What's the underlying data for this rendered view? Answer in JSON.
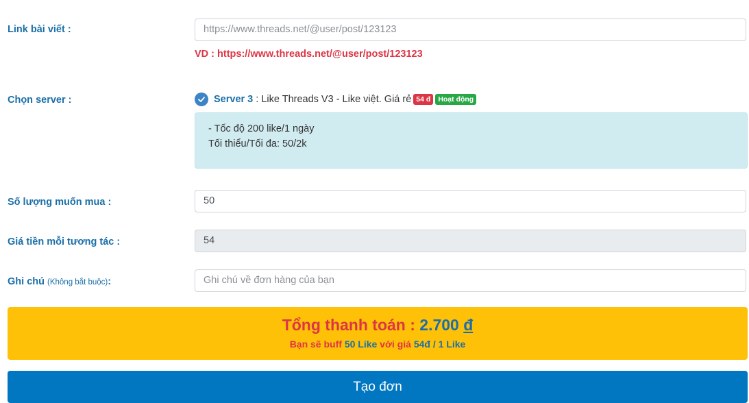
{
  "link": {
    "label": "Link bài viết :",
    "placeholder": "https://www.threads.net/@user/post/123123",
    "example": "VD : https://www.threads.net/@user/post/123123"
  },
  "server": {
    "label": "Chọn server :",
    "name": "Server 3",
    "separator": " : ",
    "description": "Like Threads V3 - Like việt. Giá rẻ",
    "price_badge": "54 đ",
    "status_badge": "Hoạt động",
    "info_line1": "- Tốc độ 200 like/1 ngày",
    "info_line2": "Tối thiểu/Tối đa: 50/2k"
  },
  "quantity": {
    "label": "Số lượng muốn mua :",
    "value": "50"
  },
  "unit_price": {
    "label": "Giá tiền mỗi tương tác :",
    "value": "54"
  },
  "note": {
    "label": "Ghi chú",
    "label_sub": "(Không bắt buộc)",
    "label_suffix": ":",
    "placeholder": "Ghi chú về đơn hàng của bạn"
  },
  "total": {
    "label": "Tổng thanh toán : ",
    "amount": "2.700",
    "currency": "đ",
    "sub_prefix": "Bạn sẽ buff ",
    "sub_qty": "50 Like",
    "sub_mid": " với giá ",
    "sub_price": "54đ / 1 Like"
  },
  "submit": {
    "label": "Tạo đơn"
  },
  "colors": {
    "accent_blue": "#1a6fa8",
    "danger_red": "#dc3545",
    "total_bg": "#ffc107",
    "button_bg": "#0077c0",
    "info_bg": "#d1ecf1",
    "success_green": "#28a745"
  }
}
